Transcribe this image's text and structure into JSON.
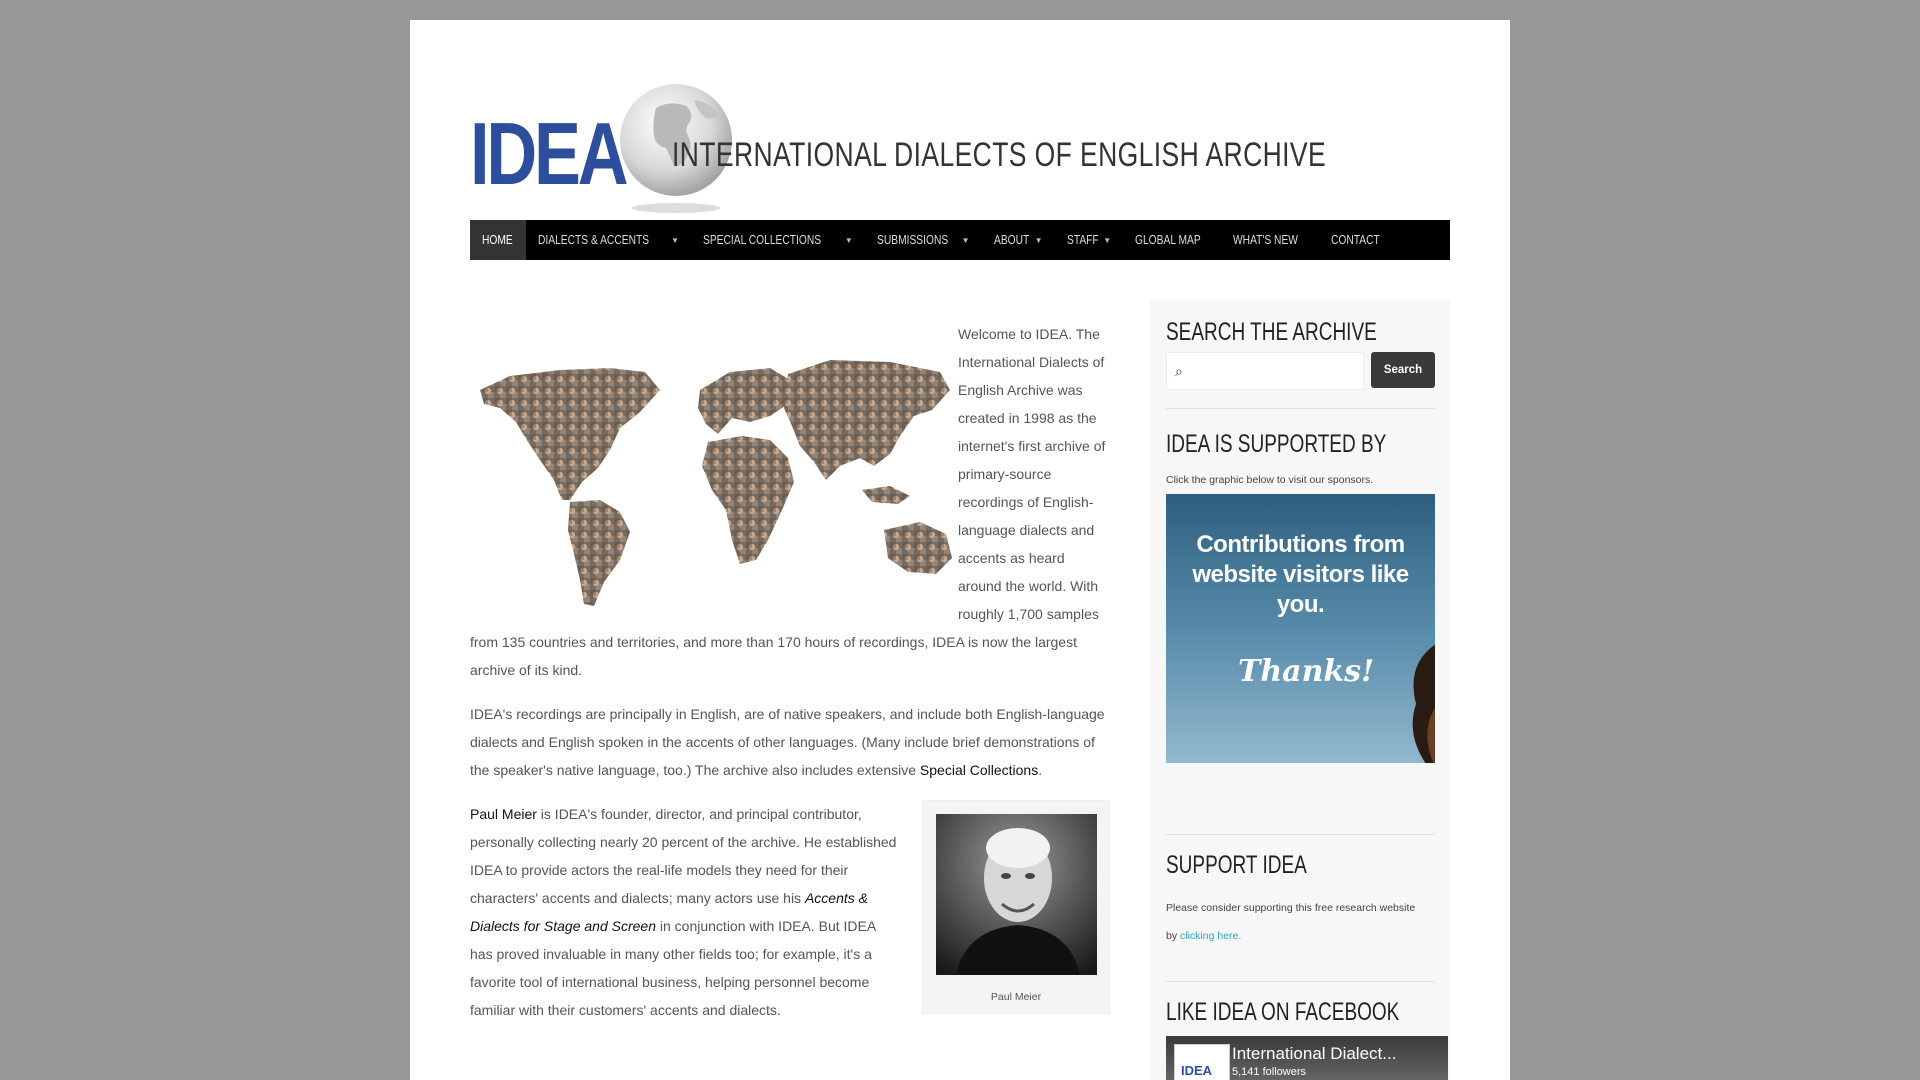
{
  "header": {
    "logo_text": "IDEA",
    "site_title": "INTERNATIONAL DIALECTS OF ENGLISH ARCHIVE"
  },
  "nav": {
    "items": [
      {
        "label": "Home",
        "active": true,
        "dropdown": false
      },
      {
        "label": "Dialects & Accents",
        "active": false,
        "dropdown": true
      },
      {
        "label": "Special Collections",
        "active": false,
        "dropdown": true
      },
      {
        "label": "Submissions",
        "active": false,
        "dropdown": true
      },
      {
        "label": "About",
        "active": false,
        "dropdown": true
      },
      {
        "label": "Staff",
        "active": false,
        "dropdown": true
      },
      {
        "label": "Global Map",
        "active": false,
        "dropdown": false
      },
      {
        "label": "What's New",
        "active": false,
        "dropdown": false
      },
      {
        "label": "Contact",
        "active": false,
        "dropdown": false
      }
    ]
  },
  "main": {
    "intro": "Welcome to IDEA. The International Dialects of English Archive was created in 1998 as the internet's first archive of primary-source recordings of English-language dialects and accents as heard around the world. With roughly 1,700 samples from 135 countries and territories, and more than 170 hours of recordings, IDEA is now the largest archive of its kind.",
    "p2_text": "IDEA's recordings are principally in English, are of native speakers, and include both English-language dialects and English spoken in the accents of other languages. (Many include brief demonstrations of the speaker's native language, too.) The archive also includes extensive ",
    "p2_link": "Special Collections",
    "p2_end": ".",
    "p3_link_name": "Paul Meier",
    "p3_text_a": " is IDEA's founder, director, and principal contributor, personally collecting nearly 20 percent of the archive. He established IDEA to provide actors the real-life models they need for their characters' accents and dialects; many actors use his ",
    "p3_book": "Accents & Dialects for Stage and Screen",
    "p3_text_b": " in conjunction with IDEA. But IDEA has proved invaluable in many other fields too; for example, it's a favorite tool of international business, helping personnel become familiar with their customers' accents and dialects.",
    "photo_caption": "Paul Meier"
  },
  "sidebar": {
    "search_title": "SEARCH THE ARCHIVE",
    "search_placeholder": "",
    "search_button": "Search",
    "supported_title": "IDEA IS SUPPORTED BY",
    "sponsor_note": "Click the graphic below to visit our sponsors.",
    "banner_text": "Contributions from website visitors like you.",
    "banner_thanks": "Thanks!",
    "support_title": "SUPPORT IDEA",
    "support_text": "Please consider supporting this free research website by ",
    "support_link": "clicking here.",
    "fb_title": "LIKE IDEA ON FACEBOOK",
    "fb_logo": "IDEA",
    "fb_name": "International Dialect...",
    "fb_followers": "5,141 followers"
  },
  "colors": {
    "brand_blue": "#2d4e9c",
    "nav_bg": "#000000",
    "link_teal": "#29a8c9",
    "page_bg": "#989898"
  }
}
